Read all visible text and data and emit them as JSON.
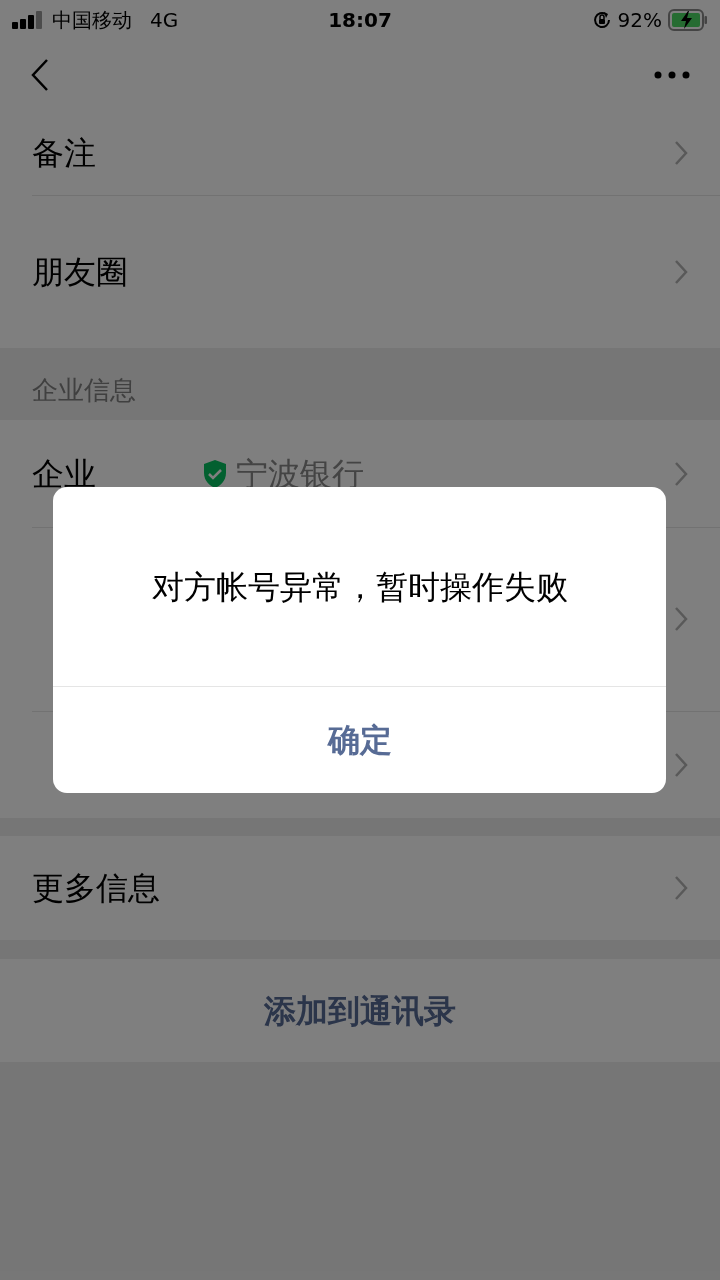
{
  "status_bar": {
    "carrier": "中国移动",
    "network": "4G",
    "time": "18:07",
    "battery": "92%"
  },
  "sections": [
    {
      "rows": [
        {
          "label": "备注",
          "chevron": true
        },
        {
          "label": "朋友圈",
          "chevron": true
        }
      ]
    },
    {
      "header": "企业信息",
      "rows": [
        {
          "label": "企业",
          "value": "宁波银行",
          "verified": true,
          "chevron": true
        },
        {
          "chevron": true
        },
        {
          "chevron": true
        }
      ]
    },
    {
      "rows": [
        {
          "label": "更多信息",
          "chevron": true
        }
      ]
    }
  ],
  "action": "添加到通讯录",
  "dialog": {
    "message": "对方帐号异常，暂时操作失败",
    "button": "确定"
  }
}
